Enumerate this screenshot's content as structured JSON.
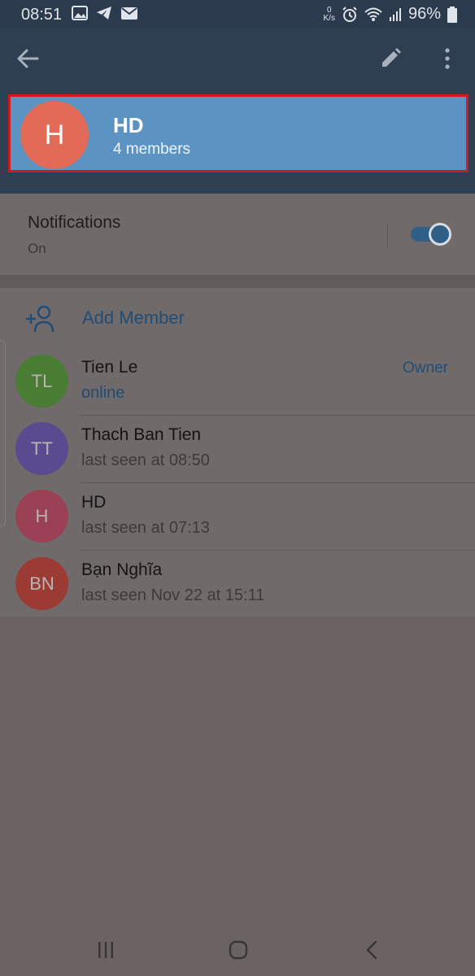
{
  "status_bar": {
    "time": "08:51",
    "left_icons": [
      "gallery-icon",
      "telegram-icon",
      "mail-icon"
    ],
    "net_speed_value": "0",
    "net_speed_unit": "K/s",
    "right_icons": [
      "alarm-icon",
      "wifi-icon",
      "signal-icon",
      "battery-icon"
    ],
    "battery": "96%"
  },
  "app_bar": {
    "icons": [
      "back-arrow-icon",
      "pencil-icon",
      "more-vertical-icon"
    ]
  },
  "profile": {
    "avatar_initial": "H",
    "name": "HD",
    "subtitle": "4 members",
    "highlight_color": "#d11a1f"
  },
  "notifications": {
    "title": "Notifications",
    "status": "On",
    "enabled": true
  },
  "members": {
    "add_label": "Add Member",
    "list": [
      {
        "initials": "TL",
        "name": "Tien Le",
        "status": "online",
        "role": "Owner",
        "color": "#4a7d34"
      },
      {
        "initials": "TT",
        "name": "Thach Ban Tien",
        "status": "last seen at 08:50",
        "role": "",
        "color": "#5a4a8f"
      },
      {
        "initials": "H",
        "name": "HD",
        "status": "last seen at 07:13",
        "role": "",
        "color": "#9a4155"
      },
      {
        "initials": "BN",
        "name": "Bạn Nghĩa",
        "status": "last seen Nov 22 at 15:11",
        "role": "",
        "color": "#9c3a34"
      }
    ]
  },
  "nav_bar": {
    "icons": [
      "recents-icon",
      "home-icon",
      "back-icon"
    ]
  },
  "colors": {
    "app_bar": "#2e3f52",
    "accent": "#5b94c2",
    "overlay_bg": "#6b6363"
  }
}
